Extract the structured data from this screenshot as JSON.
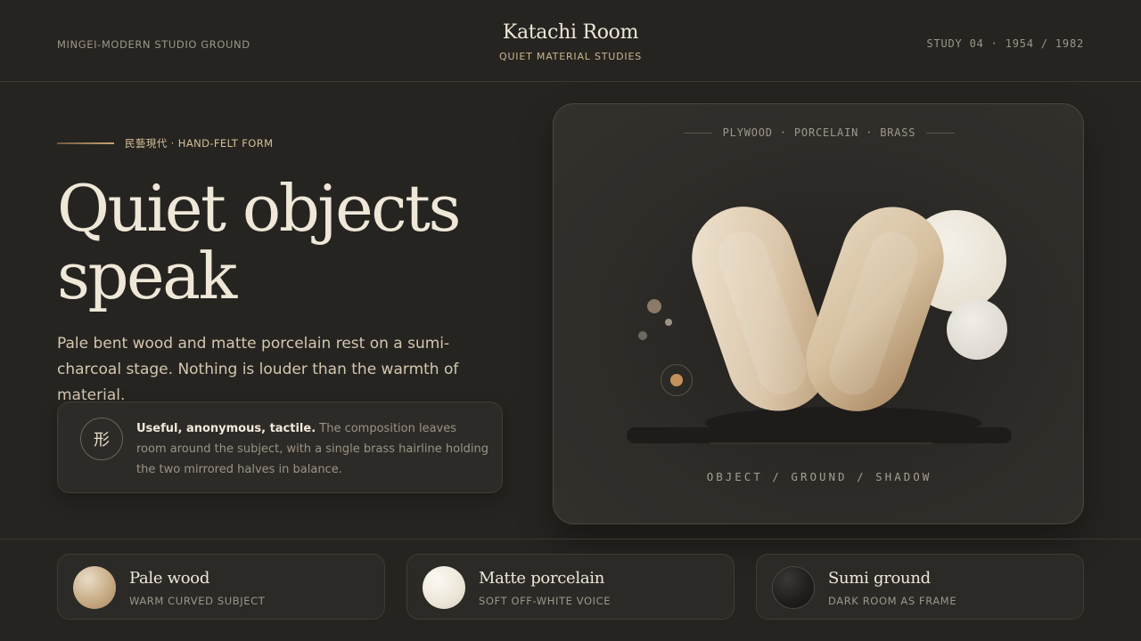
{
  "header": {
    "left_label": "MINGEI-MODERN STUDIO GROUND",
    "brand_title": "Katachi Room",
    "brand_subtitle": "QUIET MATERIAL STUDIES",
    "right_label": "STUDY 04 · 1954 / 1982"
  },
  "hero": {
    "eyebrow": "民藝現代 · HAND-FELT FORM",
    "headline_line1": "Quiet objects",
    "headline_line2": "speak",
    "lead": "Pale bent wood and matte porcelain rest on a sumi-charcoal stage. Nothing is louder than the warmth of material."
  },
  "note": {
    "icon_glyph": "形",
    "strong": "Useful, anonymous, tactile.",
    "text": " The composition leaves room around the subject, with a single brass hairline holding the two mirrored halves in balance."
  },
  "stage": {
    "materials_label": "PLYWOOD · PORCELAIN · BRASS",
    "footer_label": "OBJECT / GROUND / SHADOW"
  },
  "swatches": [
    {
      "title": "Pale wood",
      "subtitle": "WARM CURVED SUBJECT",
      "color": "#c8ad86"
    },
    {
      "title": "Matte porcelain",
      "subtitle": "SOFT OFF-WHITE VOICE",
      "color": "#ece6d8"
    },
    {
      "title": "Sumi ground",
      "subtitle": "DARK ROOM AS FRAME",
      "color": "#1e1d1b"
    }
  ],
  "colors": {
    "background": "#252420",
    "brass_accent": "#c9a576",
    "text_primary": "#efe7d8"
  }
}
